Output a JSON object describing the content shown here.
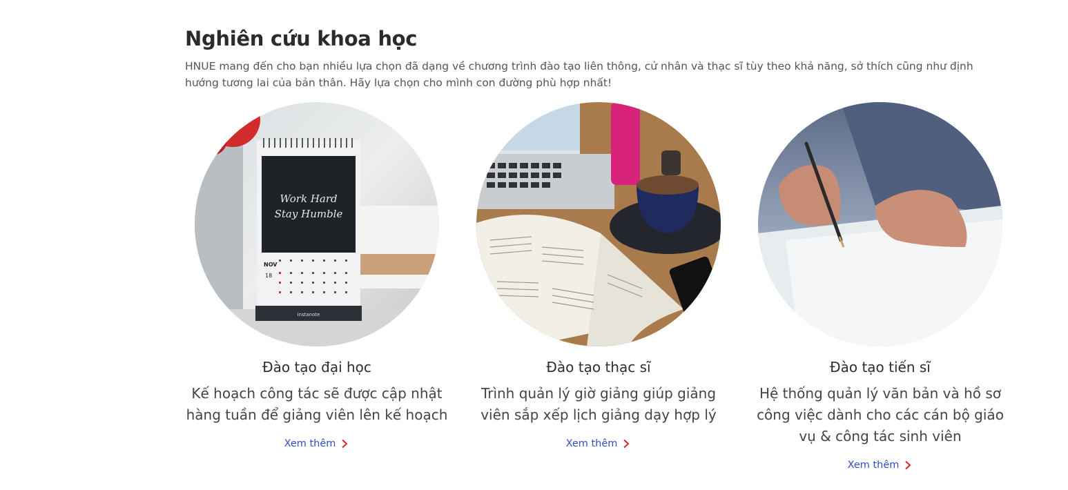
{
  "section": {
    "title": "Nghiên cứu khoa học",
    "description": "HNUE mang đến cho bạn nhiều lựa chọn đã dạng về chương trình đào tạo liên thông, cử nhân và thạc sĩ tùy theo khả năng, sở thích cũng như định hướng tương lai của bản thân. Hãy lựa chọn cho mình con đường phù hợp nhất!"
  },
  "cards": [
    {
      "title": "Đào tạo đại học",
      "text": "Kế hoạch công tác sẽ được cập nhật hàng tuần để giảng viên lên kế hoạch",
      "link": "Xem thêm",
      "image": {
        "calendar_line1": "Work Hard",
        "calendar_line2": "Stay Humble",
        "calendar_month": "NOV",
        "calendar_day": "18",
        "calendar_brand": "instanote"
      }
    },
    {
      "title": "Đào tạo thạc sĩ",
      "text": "Trình quản lý giờ giảng giúp giảng viên sắp xếp lịch giảng dạy hợp lý",
      "link": "Xem thêm"
    },
    {
      "title": "Đào tạo tiến sĩ",
      "text": "Hệ thống quản lý văn bản và hồ sơ công việc dành cho các cán bộ giáo vụ & công tác sinh viên",
      "link": "Xem thêm"
    }
  ],
  "colors": {
    "link": "#2f4fc7",
    "chevron": "#d9262b",
    "title": "#2b2b2b"
  },
  "icons": {
    "chevron": "chevron-right-icon"
  }
}
